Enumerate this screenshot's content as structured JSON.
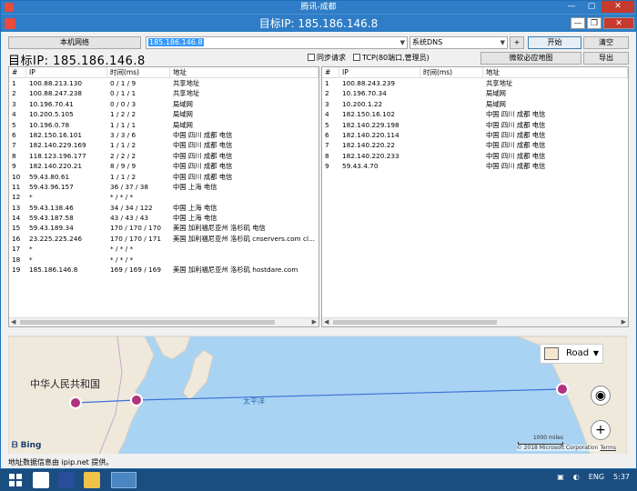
{
  "window": {
    "outer_title": "腾讯-成都",
    "inner_title": "目标IP: 185.186.146.8"
  },
  "toolbar": {
    "local_network_button": "本机网络",
    "ip_input_value": "185.186.146.8",
    "dns_select_value": "系统DNS",
    "plus_button": "+",
    "start_button": "开始",
    "clear_button": "清空",
    "target_ip_label": "目标IP:  185.186.146.8",
    "sync_request_label": "同步请求",
    "tcp_label": "TCP(80端口,管理员)",
    "map_button": "微软必应地图",
    "export_button": "导出"
  },
  "left_table": {
    "columns": [
      "#",
      "IP",
      "时间(ms)",
      "地址"
    ],
    "rows": [
      [
        "1",
        "100.88.213.130",
        "0 / 1 / 9",
        "共享地址"
      ],
      [
        "2",
        "100.88.247.238",
        "0 / 1 / 1",
        "共享地址"
      ],
      [
        "3",
        "10.196.70.41",
        "0 / 0 / 3",
        "局域网"
      ],
      [
        "4",
        "10.200.5.105",
        "1 / 2 / 2",
        "局域网"
      ],
      [
        "5",
        "10.196.0.78",
        "1 / 1 / 1",
        "局域网"
      ],
      [
        "6",
        "182.150.16.101",
        "3 / 3 / 6",
        "中国 四川 成都 电信"
      ],
      [
        "7",
        "182.140.229.169",
        "1 / 1 / 2",
        "中国 四川 成都 电信"
      ],
      [
        "8",
        "118.123.196.177",
        "2 / 2 / 2",
        "中国 四川 成都 电信"
      ],
      [
        "9",
        "182.140.220.21",
        "8 / 9 / 9",
        "中国 四川 成都 电信"
      ],
      [
        "10",
        "59.43.80.61",
        "1 / 1 / 2",
        "中国 四川 成都 电信"
      ],
      [
        "11",
        "59.43.96.157",
        "36 / 37 / 38",
        "中国 上海 电信"
      ],
      [
        "12",
        "*",
        "* / * / *",
        ""
      ],
      [
        "13",
        "59.43.138.46",
        "34 / 34 / 122",
        "中国 上海 电信"
      ],
      [
        "14",
        "59.43.187.58",
        "43 / 43 / 43",
        "中国 上海 电信"
      ],
      [
        "15",
        "59.43.189.34",
        "170 / 170 / 170",
        "美国 加利福尼亚州 洛杉矶 电信"
      ],
      [
        "16",
        "23.225.225.246",
        "170 / 170 / 171",
        "美国 加利福尼亚州 洛杉矶 cnservers.com cl..."
      ],
      [
        "17",
        "*",
        "* / * / *",
        ""
      ],
      [
        "18",
        "*",
        "* / * / *",
        ""
      ],
      [
        "19",
        "185.186.146.8",
        "169 / 169 / 169",
        "美国 加利福尼亚州 洛杉矶 hostdare.com"
      ]
    ]
  },
  "right_table": {
    "columns": [
      "#",
      "IP",
      "时间(ms)",
      "地址"
    ],
    "rows": [
      [
        "1",
        "100.88.243.239",
        "",
        "共享地址"
      ],
      [
        "2",
        "10.196.70.34",
        "",
        "局域网"
      ],
      [
        "3",
        "10.200.1.22",
        "",
        "局域网"
      ],
      [
        "4",
        "182.150.16.102",
        "",
        "中国 四川 成都 电信"
      ],
      [
        "5",
        "182.140.229.198",
        "",
        "中国 四川 成都 电信"
      ],
      [
        "6",
        "182.140.220.114",
        "",
        "中国 四川 成都 电信"
      ],
      [
        "7",
        "182.140.220.22",
        "",
        "中国 四川 成都 电信"
      ],
      [
        "8",
        "182.140.220.233",
        "",
        "中国 四川 成都 电信"
      ],
      [
        "9",
        "59.43.4.70",
        "",
        "中国 四川 成都 电信"
      ]
    ]
  },
  "map": {
    "country_label": "中华人民共和国",
    "ocean_label": "太平洋",
    "style_label": "Road",
    "bing_label": "Bing",
    "scale_label": "1000 miles",
    "copyright": "© 2018 Microsoft Corporation",
    "terms": "Terms",
    "route_color": "#3a6fd8",
    "marker_color": "#b0327f"
  },
  "status_text": "地址数据信息由 ipip.net 提供。",
  "taskbar": {
    "language": "ENG",
    "clock": "5:37"
  }
}
